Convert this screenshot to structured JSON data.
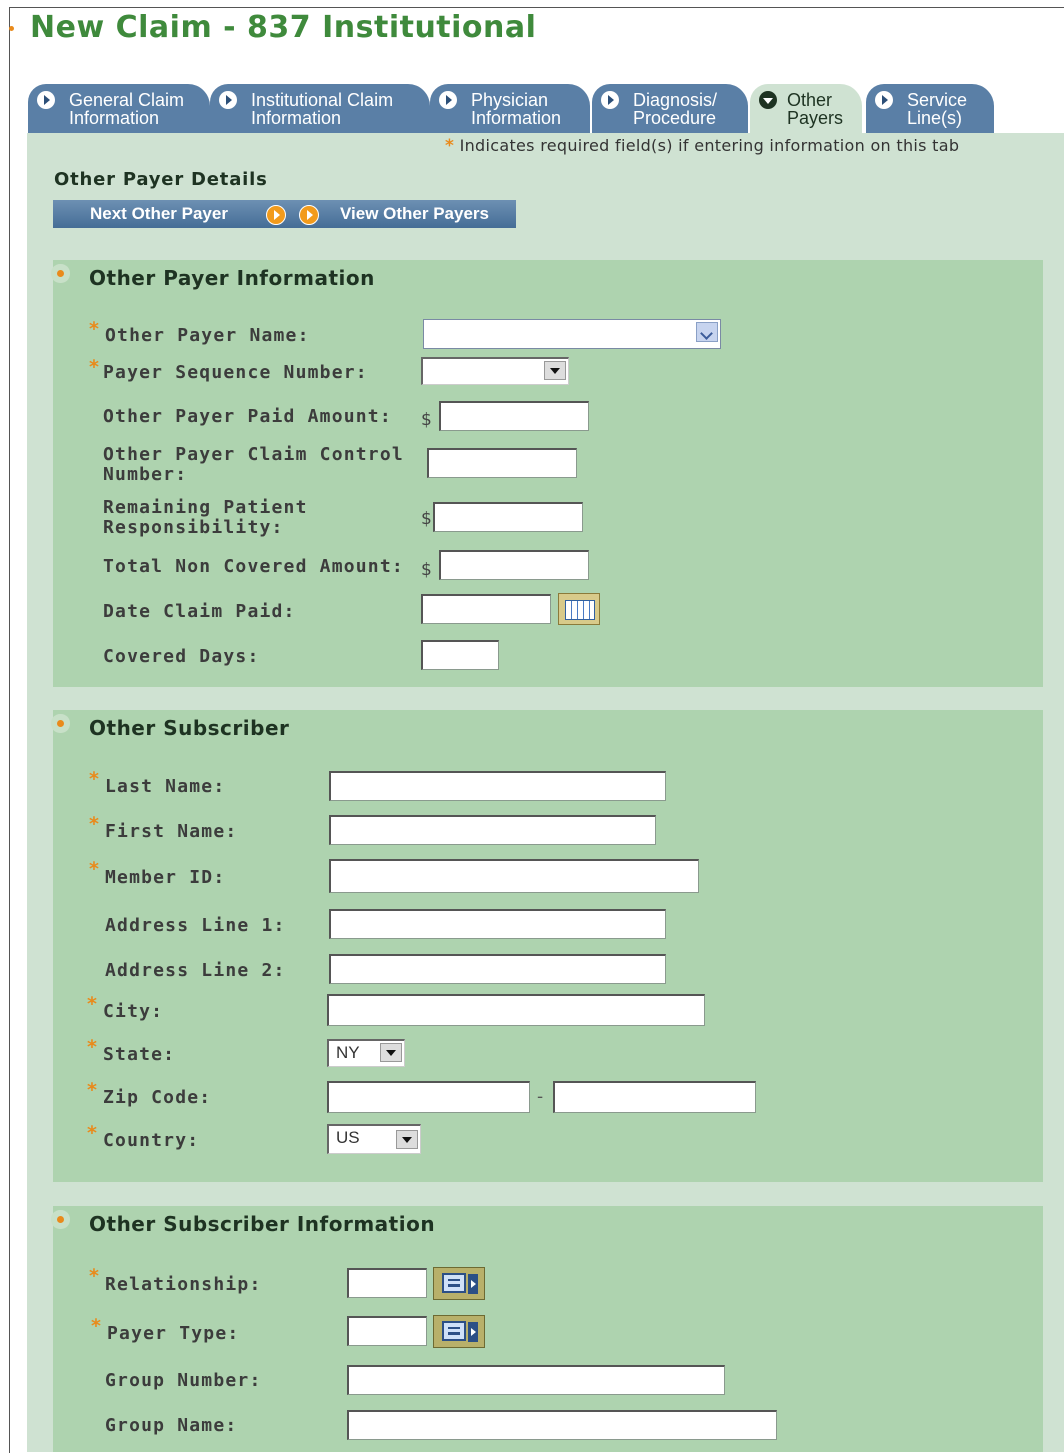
{
  "page_title": "New Claim - 837 Institutional",
  "tabs": [
    {
      "label": "General Claim\nInformation"
    },
    {
      "label": "Institutional Claim\nInformation"
    },
    {
      "label": "Physician\nInformation"
    },
    {
      "label": "Diagnosis/\nProcedure"
    },
    {
      "label": "Other\nPayers",
      "active": true
    },
    {
      "label": "Service\nLine(s)"
    }
  ],
  "required_note": {
    "star": "*",
    "text": "Indicates required field(s) if entering information on this tab"
  },
  "details_title": "Other Payer Details",
  "buttons": {
    "next": "Next Other Payer",
    "view": "View Other Payers"
  },
  "payer_info": {
    "title": "Other Payer Information",
    "name_label": "Other Payer Name:",
    "sequence_label": "Payer Sequence Number:",
    "paid_label": "Other Payer Paid Amount:",
    "control_label": "Other Payer Claim Control\nNumber:",
    "remaining_label": "Remaining Patient\nResponsibility:",
    "noncovered_label": "Total Non Covered Amount:",
    "date_label": "Date Claim Paid:",
    "days_label": "Covered Days:",
    "currency": "$"
  },
  "subscriber": {
    "title": "Other Subscriber",
    "last_label": "Last Name:",
    "first_label": "First Name:",
    "member_label": "Member ID:",
    "addr1_label": "Address Line 1:",
    "addr2_label": "Address Line 2:",
    "city_label": "City:",
    "state_label": "State:",
    "state_value": "NY",
    "zip_label": "Zip Code:",
    "zip_sep": "-",
    "country_label": "Country:",
    "country_value": "US"
  },
  "subscriber_info": {
    "title": "Other Subscriber Information",
    "relationship_label": "Relationship:",
    "payer_type_label": "Payer Type:",
    "group_number_label": "Group Number:",
    "group_name_label": "Group Name:"
  },
  "colors": {
    "accent": "#e98a1b",
    "title_green": "#3f8a3c",
    "tab_blue": "#5a7fa6",
    "panel_bg": "#cfe2d2",
    "section_bg": "#aed3af"
  },
  "icons": [
    "arrow-circle-icon",
    "arrow-down-circle-icon",
    "calendar-icon",
    "lookup-icon",
    "dropdown-chevron-icon"
  ]
}
